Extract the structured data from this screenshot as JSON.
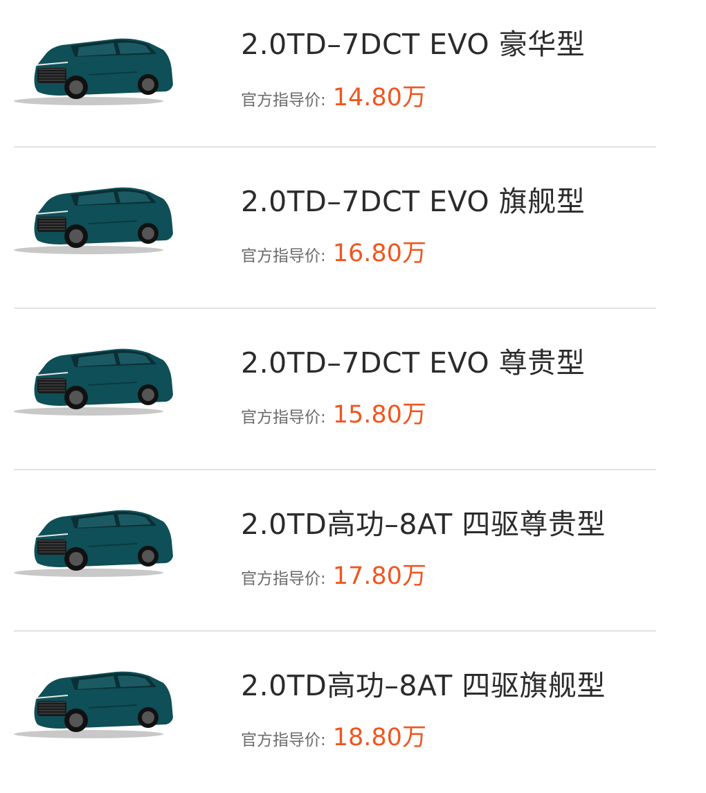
{
  "colors": {
    "title": "#2b2b2b",
    "label": "#6b6b6b",
    "price": "#f0561f",
    "divider": "#e2e2e2",
    "car_body": "#0f4f57"
  },
  "list": {
    "items": [
      {
        "name": "2.0TD–7DCT EVO 豪华型",
        "price_label": "官方指导价:",
        "price": "14.80万",
        "image_icon": "suv-car-image"
      },
      {
        "name": "2.0TD–7DCT EVO 旗舰型",
        "price_label": "官方指导价:",
        "price": "16.80万",
        "image_icon": "suv-car-image"
      },
      {
        "name": "2.0TD–7DCT EVO 尊贵型",
        "price_label": "官方指导价:",
        "price": "15.80万",
        "image_icon": "suv-car-image"
      },
      {
        "name": "2.0TD高功–8AT 四驱尊贵型",
        "price_label": "官方指导价:",
        "price": "17.80万",
        "image_icon": "suv-car-image"
      },
      {
        "name": "2.0TD高功–8AT 四驱旗舰型",
        "price_label": "官方指导价:",
        "price": "18.80万",
        "image_icon": "suv-car-image"
      }
    ]
  }
}
